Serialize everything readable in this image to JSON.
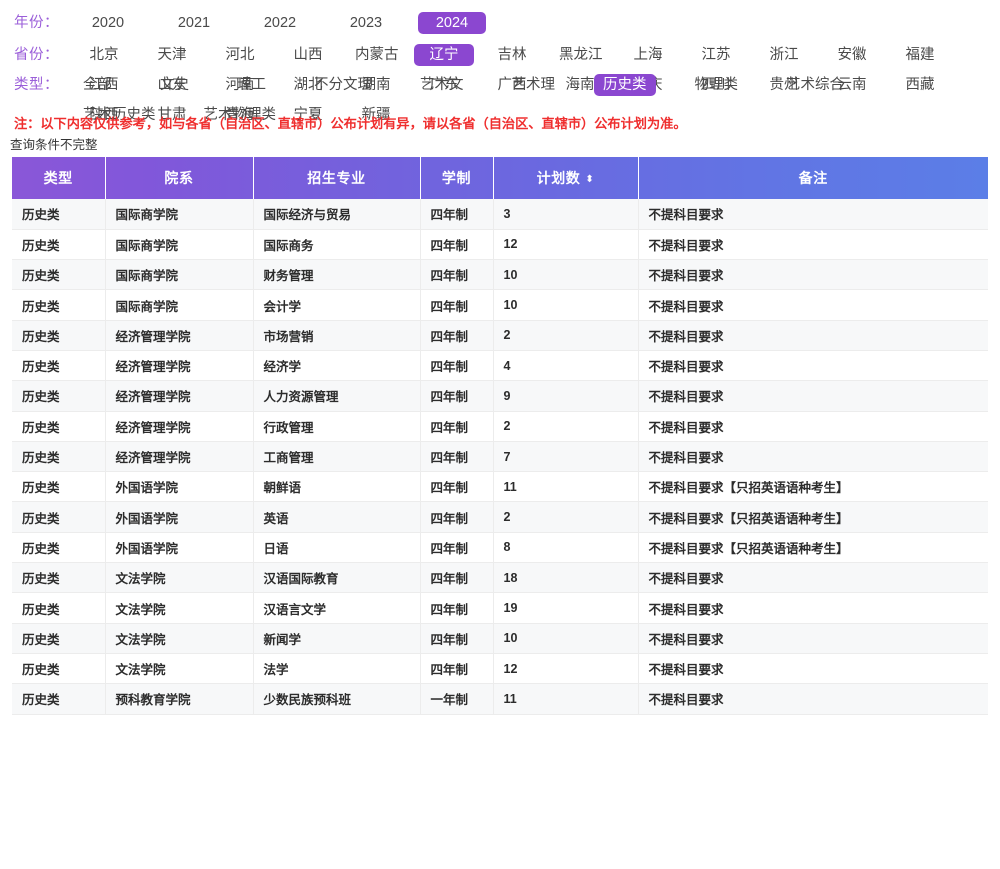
{
  "filters": {
    "year": {
      "label": "年份：",
      "options": [
        "2020",
        "2021",
        "2022",
        "2023",
        "2024"
      ],
      "selected": "2024"
    },
    "province": {
      "label": "省份：",
      "options": [
        "北京",
        "天津",
        "河北",
        "山西",
        "内蒙古",
        "辽宁",
        "吉林",
        "黑龙江",
        "上海",
        "江苏",
        "浙江",
        "安徽",
        "福建",
        "江西",
        "山东",
        "河南",
        "湖北",
        "湖南",
        "广东",
        "广西",
        "海南",
        "重庆",
        "四川",
        "贵州",
        "云南",
        "西藏",
        "陕西",
        "甘肃",
        "青海",
        "宁夏",
        "新疆"
      ],
      "selected": "辽宁"
    },
    "type": {
      "label": "类型：",
      "options": [
        "全部",
        "文史",
        "理工",
        "不分文理",
        "艺术文",
        "艺术理",
        "历史类",
        "物理类",
        "艺术综合",
        "艺术历史类",
        "艺术物理类"
      ],
      "selected": "历史类"
    }
  },
  "note": "注：以下内容仅供参考，如与各省（自治区、直辖市）公布计划有异，请以各省（自治区、直辖市）公布计划为准。",
  "subnote": "查询条件不完整",
  "table": {
    "columns": [
      "类型",
      "院系",
      "招生专业",
      "学制",
      "计划数",
      "备注"
    ],
    "sort_column": "计划数",
    "sort_icon": "⬍",
    "rows": [
      {
        "type": "历史类",
        "college": "国际商学院",
        "major": "国际经济与贸易",
        "length": "四年制",
        "plan": "3",
        "note": "不提科目要求"
      },
      {
        "type": "历史类",
        "college": "国际商学院",
        "major": "国际商务",
        "length": "四年制",
        "plan": "12",
        "note": "不提科目要求"
      },
      {
        "type": "历史类",
        "college": "国际商学院",
        "major": "财务管理",
        "length": "四年制",
        "plan": "10",
        "note": "不提科目要求"
      },
      {
        "type": "历史类",
        "college": "国际商学院",
        "major": "会计学",
        "length": "四年制",
        "plan": "10",
        "note": "不提科目要求"
      },
      {
        "type": "历史类",
        "college": "经济管理学院",
        "major": "市场营销",
        "length": "四年制",
        "plan": "2",
        "note": "不提科目要求"
      },
      {
        "type": "历史类",
        "college": "经济管理学院",
        "major": "经济学",
        "length": "四年制",
        "plan": "4",
        "note": "不提科目要求"
      },
      {
        "type": "历史类",
        "college": "经济管理学院",
        "major": "人力资源管理",
        "length": "四年制",
        "plan": "9",
        "note": "不提科目要求"
      },
      {
        "type": "历史类",
        "college": "经济管理学院",
        "major": "行政管理",
        "length": "四年制",
        "plan": "2",
        "note": "不提科目要求"
      },
      {
        "type": "历史类",
        "college": "经济管理学院",
        "major": "工商管理",
        "length": "四年制",
        "plan": "7",
        "note": "不提科目要求"
      },
      {
        "type": "历史类",
        "college": "外国语学院",
        "major": "朝鲜语",
        "length": "四年制",
        "plan": "11",
        "note": "不提科目要求【只招英语语种考生】"
      },
      {
        "type": "历史类",
        "college": "外国语学院",
        "major": "英语",
        "length": "四年制",
        "plan": "2",
        "note": "不提科目要求【只招英语语种考生】"
      },
      {
        "type": "历史类",
        "college": "外国语学院",
        "major": "日语",
        "length": "四年制",
        "plan": "8",
        "note": "不提科目要求【只招英语语种考生】"
      },
      {
        "type": "历史类",
        "college": "文法学院",
        "major": "汉语国际教育",
        "length": "四年制",
        "plan": "18",
        "note": "不提科目要求"
      },
      {
        "type": "历史类",
        "college": "文法学院",
        "major": "汉语言文学",
        "length": "四年制",
        "plan": "19",
        "note": "不提科目要求"
      },
      {
        "type": "历史类",
        "college": "文法学院",
        "major": "新闻学",
        "length": "四年制",
        "plan": "10",
        "note": "不提科目要求"
      },
      {
        "type": "历史类",
        "college": "文法学院",
        "major": "法学",
        "length": "四年制",
        "plan": "12",
        "note": "不提科目要求"
      },
      {
        "type": "历史类",
        "college": "预科教育学院",
        "major": "少数民族预科班",
        "length": "一年制",
        "plan": "11",
        "note": "不提科目要求"
      }
    ]
  },
  "colors": {
    "accent_purple": "#8b47d0",
    "label_purple": "#9b5fd9",
    "header_from": "#8a57d8",
    "header_to": "#5b7ee7",
    "note_red": "#ef2f2f",
    "stripe": "#f7f8f9"
  }
}
